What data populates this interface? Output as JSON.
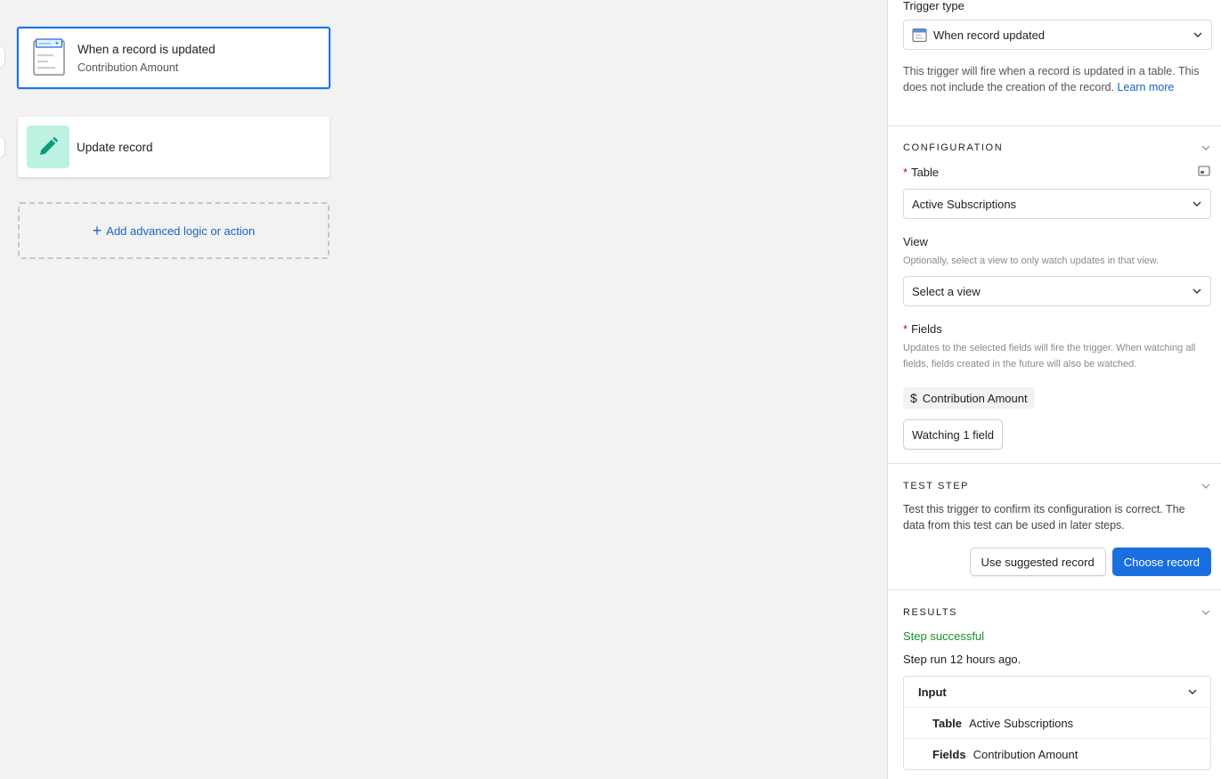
{
  "canvas": {
    "trigger_card": {
      "title": "When a record is updated",
      "subtitle": "Contribution Amount"
    },
    "action_card": {
      "title": "Update record"
    },
    "add_button": {
      "label": "Add advanced logic or action"
    }
  },
  "panel": {
    "trigger_type": {
      "label": "Trigger type",
      "value": "When record updated",
      "description": "This trigger will fire when a record is updated in a table. This does not include the creation of the record.",
      "learn_more": "Learn more"
    },
    "configuration": {
      "title": "CONFIGURATION",
      "table_label": "Table",
      "table_value": "Active Subscriptions",
      "view_label": "View",
      "view_help": "Optionally, select a view to only watch updates in that view.",
      "view_placeholder": "Select a view",
      "fields_label": "Fields",
      "fields_help": "Updates to the selected fields will fire the trigger. When watching all fields, fields created in the future will also be watched.",
      "selected_field": "Contribution Amount",
      "watching_button": "Watching 1 field"
    },
    "test_step": {
      "title": "TEST STEP",
      "description": "Test this trigger to confirm its configuration is correct. The data from this test can be used in later steps.",
      "suggested_button": "Use suggested record",
      "choose_button": "Choose record"
    },
    "results": {
      "title": "RESULTS",
      "status": "Step successful",
      "run_time": "Step run 12 hours ago.",
      "input_header": "Input",
      "rows": [
        {
          "key": "Table",
          "value": "Active Subscriptions"
        },
        {
          "key": "Fields",
          "value": "Contribution Amount"
        }
      ]
    }
  },
  "colors": {
    "accent": "#1a6fe0",
    "success": "#188f2e",
    "required": "#d0021b",
    "action_icon_bg": "#bdf2e3"
  }
}
